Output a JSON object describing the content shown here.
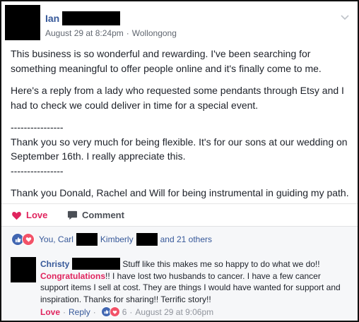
{
  "post": {
    "author": "Ian",
    "date": "August 29 at 8:24pm",
    "separator": "·",
    "location": "Wollongong",
    "paragraphs": [
      "This business is so wonderful and rewarding. I've been searching for something meaningful to offer people online and it's finally come to me.",
      "Here's a reply from a lady who requested some pendants through Etsy and I had to check we could deliver in time for a special event."
    ],
    "divider": "----------------",
    "quote": "Thank you so very much for being flexible. It's for our sons at our wedding on September 16th. I really appreciate this.",
    "closing": "Thank you Donald, Rachel and Will for being instrumental in guiding my path.",
    "menu_icon": "chevron-down-icon"
  },
  "actions": {
    "love_label": "Love",
    "comment_label": "Comment",
    "love_color": "#e0245e"
  },
  "reactions": {
    "you": "You, Carl",
    "kimberly": "Kimberly",
    "others": "and 21 others",
    "icons": [
      "like-icon",
      "heart-icon"
    ]
  },
  "comment": {
    "author": "Christy",
    "text_line1": "Stuff like this makes me so happy to do what we do!!",
    "congrats": "Congratulations",
    "text_rest": "!! I have lost two husbands to cancer. I have a few cancer support items I sell at cost. They are things I would have wanted for support and inspiration. Thanks for sharing!! Terrific story!!",
    "love_label": "Love",
    "reply_label": "Reply",
    "reaction_count": "6",
    "timestamp": "August 29 at 9:06pm",
    "dot": "·"
  },
  "colors": {
    "link_blue": "#365899",
    "love_red": "#e0245e",
    "text_gray": "#616770"
  }
}
